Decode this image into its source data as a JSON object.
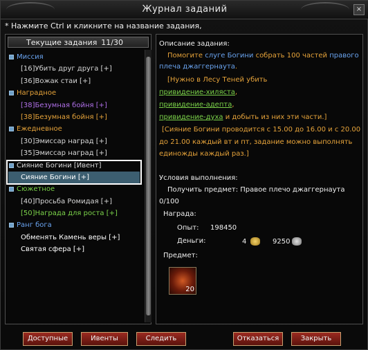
{
  "window": {
    "title": "Журнал заданий",
    "close_label": "×",
    "hint": "* Нажмите Ctrl и кликните на название задания,"
  },
  "left": {
    "header_title": "Текущие задания",
    "header_count": "11/30",
    "rows": [
      {
        "type": "cat",
        "label": "Миссия",
        "color": "#6aa4f0"
      },
      {
        "type": "item",
        "label": "[16]Убить друг друга  [+]",
        "color": "#d8d8d8"
      },
      {
        "type": "item",
        "label": "[36]Вожак стаи  [+]",
        "color": "#d8d8d8"
      },
      {
        "type": "cat",
        "label": "Наградное",
        "color": "#e6a33a"
      },
      {
        "type": "item",
        "label": "[38]Безумная бойня  [+]",
        "color": "#b070e8"
      },
      {
        "type": "item",
        "label": "[38]Безумная бойня  [+]",
        "color": "#e6a33a"
      },
      {
        "type": "cat",
        "label": "Ежедневное",
        "color": "#e6a33a"
      },
      {
        "type": "item",
        "label": "[30]Эмиссар наград  [+]",
        "color": "#d8d8d8"
      },
      {
        "type": "item",
        "label": "[35]Эмиссар наград  [+]",
        "color": "#d8d8d8"
      },
      {
        "type": "cat",
        "label": "Сияние Богини [Ивент]",
        "color": "#d8d8d8"
      },
      {
        "type": "item",
        "label": "Сияние Богини  [+]",
        "color": "#ffffff",
        "selected": true
      },
      {
        "type": "cat",
        "label": "Сюжетное",
        "color": "#7cd44a"
      },
      {
        "type": "item",
        "label": "[40]Просьба Ромидая  [+]",
        "color": "#d8d8d8"
      },
      {
        "type": "item",
        "label": "[50]Награда для роста  [+]",
        "color": "#7cd44a"
      },
      {
        "type": "cat",
        "label": "Ранг бога",
        "color": "#6aa4f0"
      },
      {
        "type": "item",
        "label": "Обменять Камень веры  [+]",
        "color": "#ffffff"
      },
      {
        "type": "item",
        "label": "Святая сфера  [+]",
        "color": "#ffffff"
      }
    ]
  },
  "right": {
    "desc_label": "Описание задания:",
    "line1_a": "Помогите ",
    "line1_b": "слуге Богини",
    "line1_c": " собрать ",
    "line1_d": "100",
    "line1_e": " частей ",
    "line1_f": "правого",
    "line2": "плеча джаггернаута",
    "line2_dot": ".",
    "line3": "[Нужно в Лесу Теней убить",
    "link1": "привидение-хиляста",
    "link1_sep": ",",
    "link2": "привидение-адепта",
    "link2_sep": ",",
    "link3": "привидение-духа",
    "link3_tail": " и добыть из них эти части.]",
    "event1": "[Сияние Богини проводится с 15.00 до 16.00 и с 20.00",
    "event2": "до 21.00 каждый вт и пт, задание можно выполнять",
    "event3": "единожды каждый раз.]",
    "cond_label": "Условия выполнения:",
    "cond_item": "Получить предмет:  Правое плечо джаггернаута",
    "progress": "0/100",
    "reward_label": "Награда:",
    "exp_label": "Опыт:",
    "exp_value": "198450",
    "money_label": "Деньги:",
    "gold_value": "4",
    "silver_value": "9250",
    "item_label": "Предмет:",
    "item_qty": "20"
  },
  "buttons": {
    "available": "Доступные",
    "events": "Ивенты",
    "track": "Следить",
    "refuse": "Отказаться",
    "close": "Закрыть"
  }
}
